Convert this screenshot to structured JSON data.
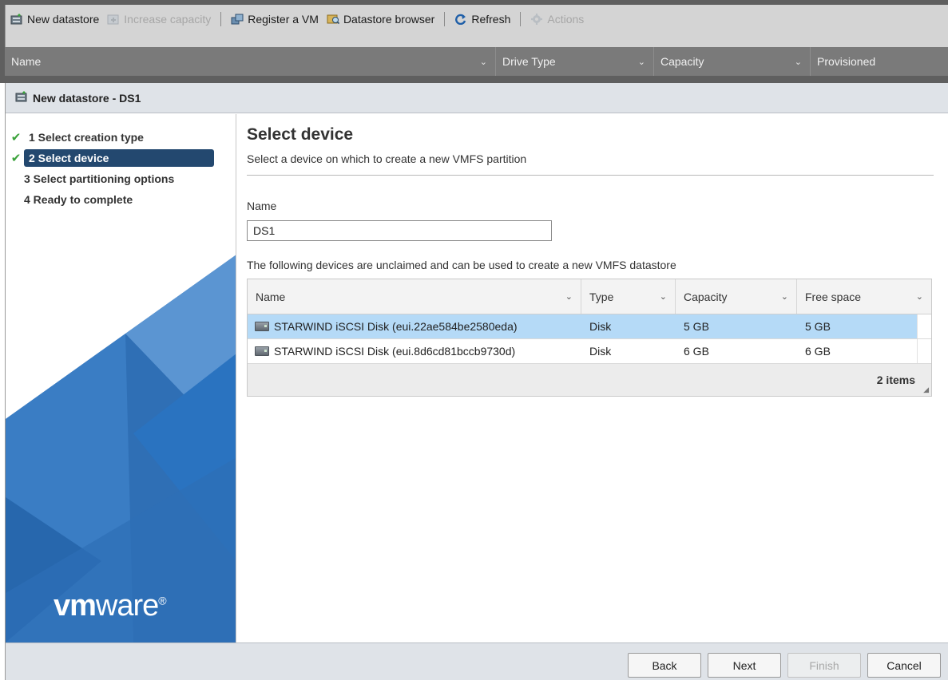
{
  "toolbar": {
    "new_datastore": "New datastore",
    "increase_capacity": "Increase capacity",
    "register_vm": "Register a VM",
    "datastore_browser": "Datastore browser",
    "refresh": "Refresh",
    "actions": "Actions"
  },
  "bg_columns": [
    "Name",
    "Drive Type",
    "Capacity",
    "Provisioned"
  ],
  "dialog": {
    "title": "New datastore - DS1",
    "steps": [
      {
        "label": "1 Select creation type",
        "done": true
      },
      {
        "label": "2 Select device",
        "done": true,
        "active": true
      },
      {
        "label": "3 Select partitioning options",
        "done": false
      },
      {
        "label": "4 Ready to complete",
        "done": false
      }
    ],
    "logo_bold": "vm",
    "logo_rest": "ware",
    "logo_mark": "®",
    "heading": "Select device",
    "subtitle": "Select a device on which to create a new VMFS partition",
    "name_label": "Name",
    "name_value": "DS1",
    "devices_note": "The following devices are unclaimed and can be used to create a new VMFS datastore",
    "grid": {
      "columns": [
        "Name",
        "Type",
        "Capacity",
        "Free space"
      ],
      "rows": [
        {
          "name": "STARWIND iSCSI Disk (eui.22ae584be2580eda)",
          "type": "Disk",
          "capacity": "5 GB",
          "free": "5 GB",
          "selected": true
        },
        {
          "name": "STARWIND iSCSI Disk (eui.8d6cd81bccb9730d)",
          "type": "Disk",
          "capacity": "6 GB",
          "free": "6 GB",
          "selected": false
        }
      ],
      "footer": "2 items"
    },
    "buttons": {
      "back": "Back",
      "next": "Next",
      "finish": "Finish",
      "cancel": "Cancel"
    }
  },
  "colors": {
    "active_step": "#23486f",
    "selected_row": "#b5daf7",
    "check": "#3aa23a",
    "sidebar_blue": "#2f6fb5"
  },
  "icons": [
    "new-datastore-icon",
    "increase-capacity-icon",
    "register-vm-icon",
    "datastore-browser-icon",
    "refresh-icon",
    "actions-gear-icon",
    "check-icon",
    "disk-icon",
    "chevron-down-icon",
    "resize-grip-icon"
  ]
}
